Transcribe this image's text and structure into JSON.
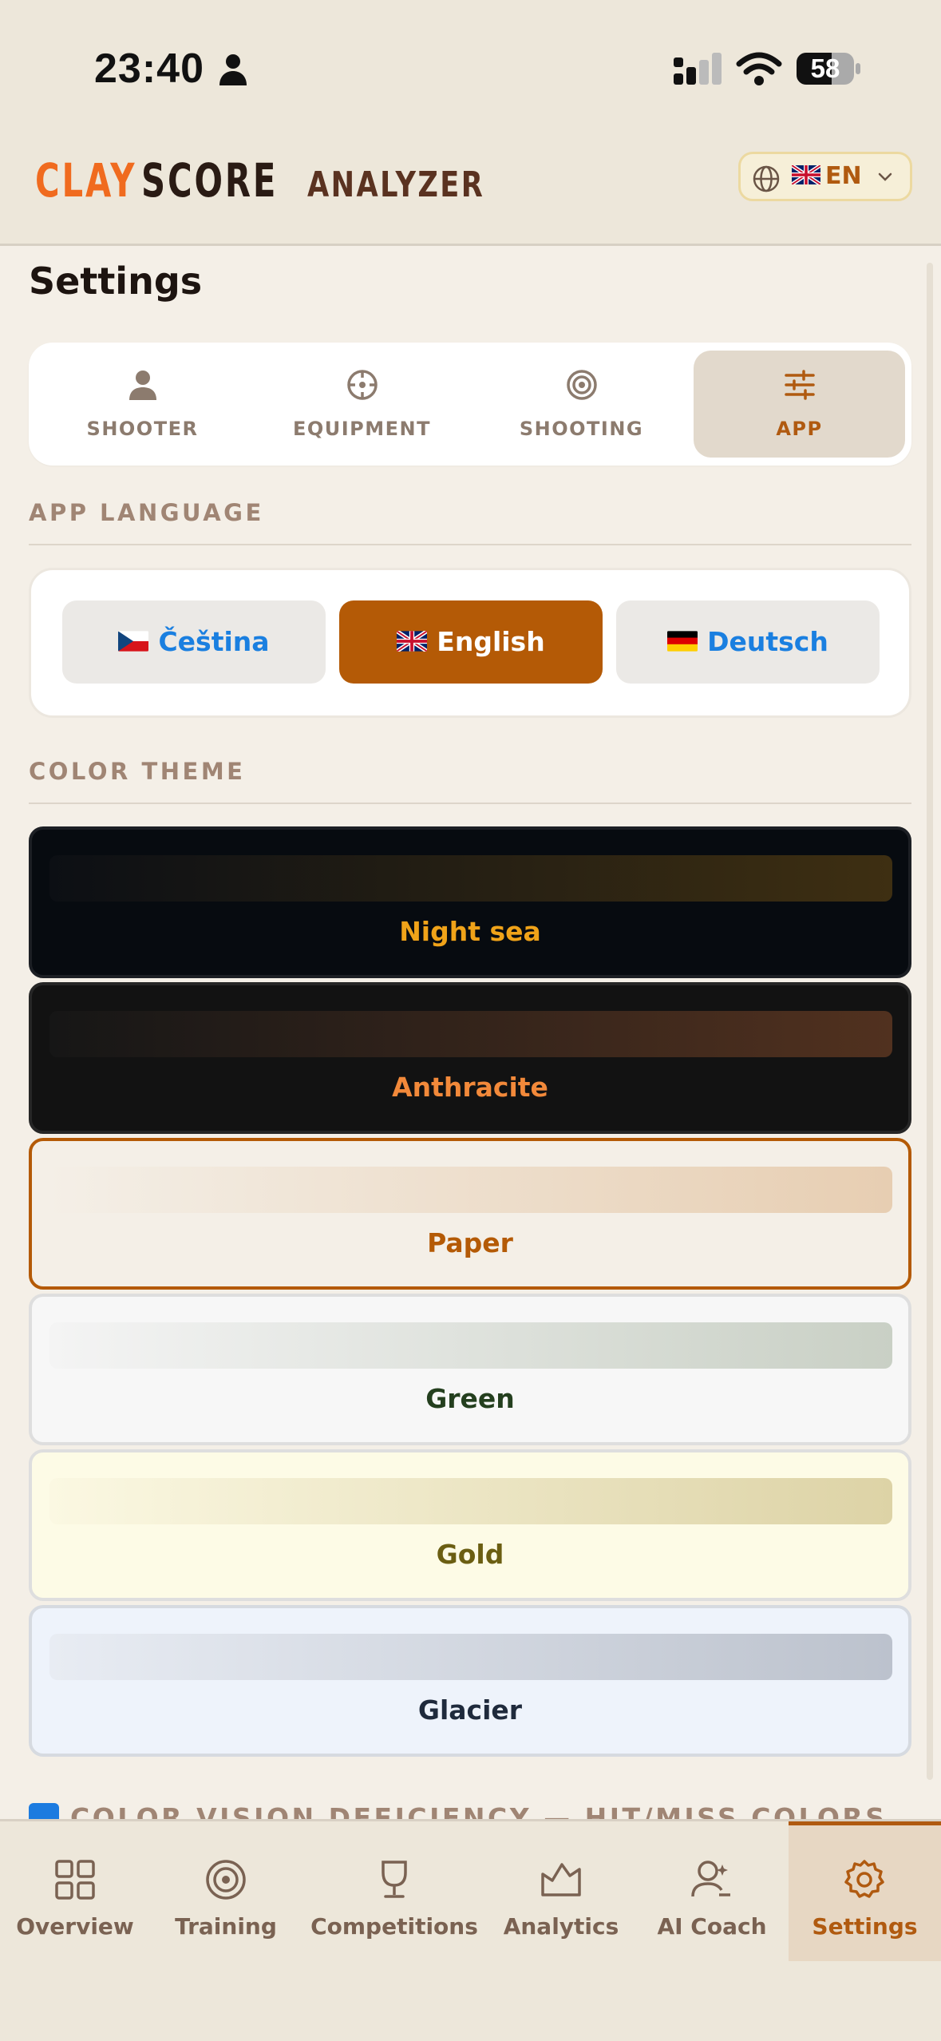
{
  "status_bar": {
    "time": "23:40",
    "battery": "58"
  },
  "header": {
    "logo_part1": "CLAY",
    "logo_part2": "SCORE",
    "logo_part3": "ANALYZER",
    "language_code": "EN"
  },
  "page": {
    "title": "Settings"
  },
  "tabs": [
    {
      "label": "SHOOTER",
      "icon": "person-icon",
      "active": false
    },
    {
      "label": "EQUIPMENT",
      "icon": "crosshair-icon",
      "active": false
    },
    {
      "label": "SHOOTING",
      "icon": "target-icon",
      "active": false
    },
    {
      "label": "APP",
      "icon": "sliders-icon",
      "active": true
    }
  ],
  "language_section": {
    "label": "APP LANGUAGE",
    "options": [
      {
        "label": "Čeština",
        "flag": "cz",
        "active": false
      },
      {
        "label": "English",
        "flag": "gb",
        "active": true
      },
      {
        "label": "Deutsch",
        "flag": "de",
        "active": false
      }
    ]
  },
  "theme_section": {
    "label": "COLOR THEME",
    "themes": [
      {
        "name": "Night sea",
        "bg": "#070b10",
        "border": "#1c1f24",
        "text": "#f0a319",
        "swatch_from": "#0c0f14",
        "swatch_to": "#3e2f12"
      },
      {
        "name": "Anthracite",
        "bg": "#121212",
        "border": "#262626",
        "text": "#f2893a",
        "swatch_from": "#161616",
        "swatch_to": "#51311f"
      },
      {
        "name": "Paper",
        "bg": "#f4efe7",
        "border": "#b45a06",
        "text": "#b45a06",
        "swatch_from": "#f4efe7",
        "swatch_to": "#e7ceb2"
      },
      {
        "name": "Green",
        "bg": "#f7f7f7",
        "border": "#dedede",
        "text": "#243f1e",
        "swatch_from": "#f4f4f4",
        "swatch_to": "#c9d0c5"
      },
      {
        "name": "Gold",
        "bg": "#fdfbe6",
        "border": "#dedede",
        "text": "#6b5e12",
        "swatch_from": "#fbf8e2",
        "swatch_to": "#ddd3a6"
      },
      {
        "name": "Glacier",
        "bg": "#eef3fb",
        "border": "#d6dae0",
        "text": "#1f2a3c",
        "swatch_from": "#e8ecf3",
        "swatch_to": "#bcc2cd"
      }
    ]
  },
  "cvd_section": {
    "label": "COLOR VISION DEFICIENCY — HIT/MISS COLORS"
  },
  "bottom_nav": [
    {
      "label": "Overview",
      "icon": "grid-icon",
      "active": false
    },
    {
      "label": "Training",
      "icon": "target-icon",
      "active": false
    },
    {
      "label": "Competitions",
      "icon": "trophy-icon",
      "active": false
    },
    {
      "label": "Analytics",
      "icon": "chart-icon",
      "active": false
    },
    {
      "label": "AI Coach",
      "icon": "coach-icon",
      "active": false
    },
    {
      "label": "Settings",
      "icon": "gear-icon",
      "active": true
    }
  ],
  "colors": {
    "accent": "#b45a06",
    "link": "#1a7fe0",
    "background": "#f4efe7"
  }
}
